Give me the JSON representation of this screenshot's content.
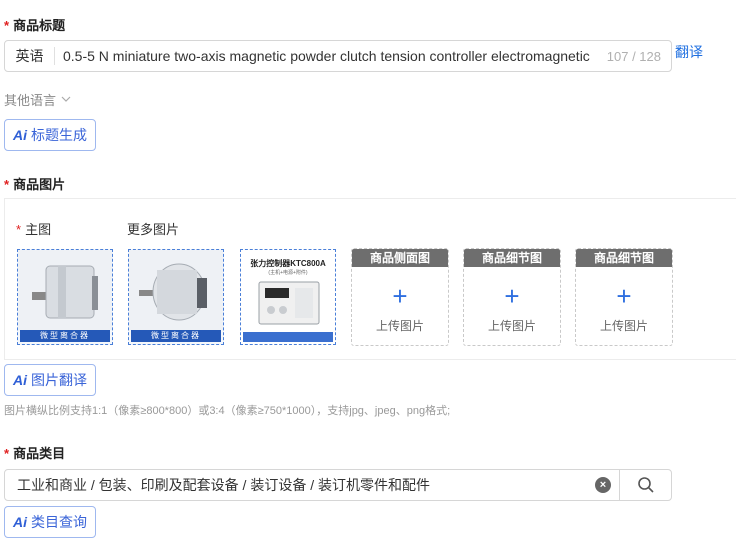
{
  "title_section": {
    "required_mark": "*",
    "label": "商品标题",
    "language": "英语",
    "value": "0.5-5 N miniature two-axis magnetic powder clutch tension controller electromagnetic",
    "counter": "107 / 128",
    "translate_link": "翻译",
    "other_languages": "其他语言",
    "ai_button_mark": "Ai",
    "ai_button_label": "标题生成"
  },
  "image_section": {
    "required_mark": "*",
    "label": "商品图片",
    "main_required_mark": "*",
    "main_label": "主图",
    "more_label": "更多图片",
    "thumbnails": [
      {
        "band": "微型离合器"
      },
      {
        "band": "微型离合器"
      },
      {
        "title": "张力控制器KTC800A",
        "subtitle": "(主机+电源+附件)"
      }
    ],
    "upload_slots": [
      {
        "header": "商品侧面图",
        "plus": "+",
        "text": "上传图片"
      },
      {
        "header": "商品细节图",
        "plus": "+",
        "text": "上传图片"
      },
      {
        "header": "商品细节图",
        "plus": "+",
        "text": "上传图片"
      }
    ],
    "ai_button_mark": "Ai",
    "ai_button_label": "图片翻译",
    "hint": "图片横纵比例支持1:1（像素≥800*800）或3:4（像素≥750*1000），支持jpg、jpeg、png格式;"
  },
  "category_section": {
    "required_mark": "*",
    "label": "商品类目",
    "value": "工业和商业 / 包装、印刷及配套设备 / 装订设备 / 装订机零件和配件",
    "ai_button_mark": "Ai",
    "ai_button_label": "类目查询"
  },
  "colors": {
    "required": "#e02020",
    "link": "#1f6fe0",
    "ai_border": "#9fb8ef"
  }
}
